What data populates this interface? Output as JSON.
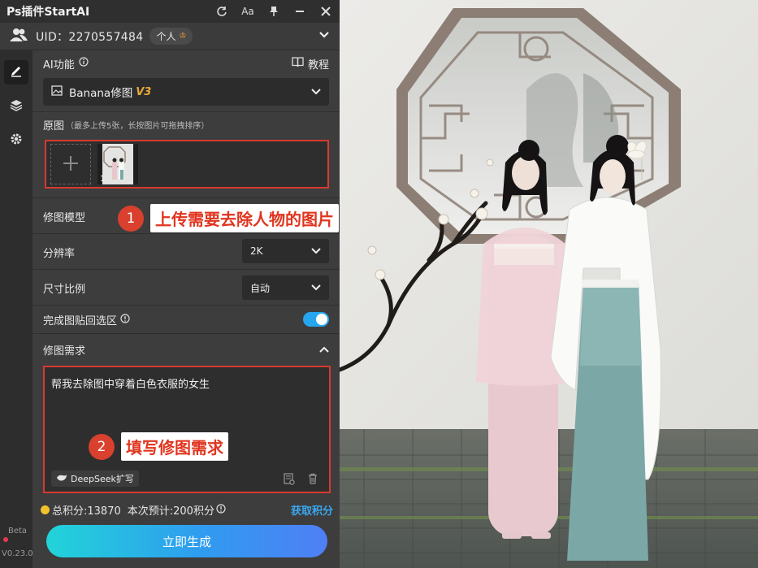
{
  "app": {
    "title": "Ps插件StartAI"
  },
  "user": {
    "uid_text": "UID：2270557484",
    "account_type": "个人"
  },
  "ai_function": {
    "label": "AI功能",
    "tutorial_label": "教程",
    "selected_tool": "Banana修图",
    "selected_tool_version": "V3"
  },
  "source_image": {
    "label": "原图",
    "hint": "（最多上传5张，长按图片可拖拽排序）",
    "thumbnail_index": "1"
  },
  "settings": {
    "model_label": "修图模型",
    "resolution_label": "分辨率",
    "resolution_value": "2K",
    "ratio_label": "尺寸比例",
    "ratio_value": "自动",
    "paste_back_label": "完成图贴回选区",
    "paste_back_enabled": true
  },
  "requirement": {
    "label": "修图需求",
    "text": "帮我去除图中穿着白色衣服的女生",
    "deepseek_label": "DeepSeek扩写"
  },
  "footer": {
    "points_text": "总积分:13870",
    "estimate_text": "本次预计:200积分",
    "get_points_label": "获取积分",
    "generate_label": "立即生成",
    "beta_label": "Beta",
    "version_label": "V0.23.0"
  },
  "callouts": [
    {
      "number": "1",
      "text": "上传需要去除人物的图片"
    },
    {
      "number": "2",
      "text": "填写修图需求"
    }
  ],
  "colors": {
    "accent_red": "#d63b2f",
    "toggle_blue": "#27a6f0",
    "link_blue": "#3aa7f0",
    "version_orange": "#e8a93a"
  }
}
